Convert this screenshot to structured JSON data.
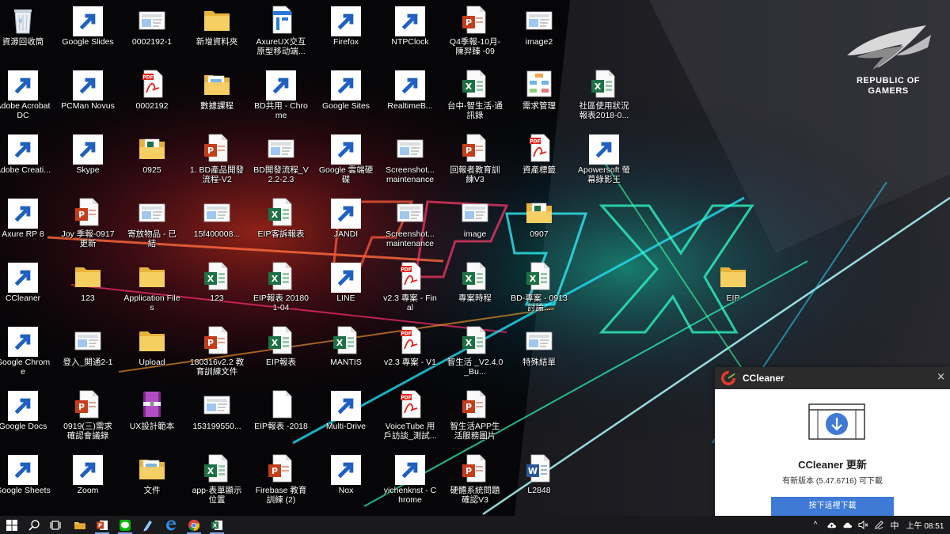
{
  "desktop": {
    "icons": [
      {
        "label": "資源回收筒",
        "icon": "recycle-bin-icon",
        "col": 0,
        "row": 0,
        "shortcut": false
      },
      {
        "label": "Google Slides",
        "icon": "google-slides-icon",
        "col": 1,
        "row": 0,
        "shortcut": true
      },
      {
        "label": "0002192-1",
        "icon": "image-file-icon",
        "col": 2,
        "row": 0,
        "shortcut": false
      },
      {
        "label": "新增資料夾",
        "icon": "folder-icon",
        "col": 3,
        "row": 0,
        "shortcut": false
      },
      {
        "label": "AxureUX交互原型移动端...",
        "icon": "axure-file-icon",
        "col": 4,
        "row": 0,
        "shortcut": false
      },
      {
        "label": "Firefox",
        "icon": "firefox-icon",
        "col": 5,
        "row": 0,
        "shortcut": true
      },
      {
        "label": "NTPClock",
        "icon": "ntpclock-icon",
        "col": 6,
        "row": 0,
        "shortcut": true
      },
      {
        "label": "Q4季報-10月-陳羿臻 -09",
        "icon": "powerpoint-file-icon",
        "col": 7,
        "row": 0,
        "shortcut": false
      },
      {
        "label": "image2",
        "icon": "image-file-icon",
        "col": 8,
        "row": 0,
        "shortcut": false
      },
      {
        "label": "Adobe Acrobat DC",
        "icon": "acrobat-icon",
        "col": 0,
        "row": 1,
        "shortcut": true
      },
      {
        "label": "PCMan Novus",
        "icon": "pcman-icon",
        "col": 1,
        "row": 1,
        "shortcut": true
      },
      {
        "label": "0002192",
        "icon": "pdf-file-icon",
        "col": 2,
        "row": 1,
        "shortcut": false
      },
      {
        "label": "數據課程",
        "icon": "folder-docs-icon",
        "col": 3,
        "row": 1,
        "shortcut": false
      },
      {
        "label": "BD共用 - Chrome",
        "icon": "chrome-profile-icon",
        "col": 4,
        "row": 1,
        "shortcut": true
      },
      {
        "label": "Google Sites",
        "icon": "chrome-icon",
        "col": 5,
        "row": 1,
        "shortcut": true
      },
      {
        "label": "RealtimeB...",
        "icon": "realtime-board-icon",
        "col": 6,
        "row": 1,
        "shortcut": true
      },
      {
        "label": "台中-智生活-通訊錄",
        "icon": "excel-file-icon",
        "col": 7,
        "row": 1,
        "shortcut": false
      },
      {
        "label": "需求管理",
        "icon": "diagram-file-icon",
        "col": 8,
        "row": 1,
        "shortcut": false
      },
      {
        "label": "社區使用狀況報表2018-0...",
        "icon": "excel-file-icon",
        "col": 9,
        "row": 1,
        "shortcut": false
      },
      {
        "label": "Adobe Creati...",
        "icon": "creative-cloud-icon",
        "col": 0,
        "row": 2,
        "shortcut": true
      },
      {
        "label": "Skype",
        "icon": "skype-icon",
        "col": 1,
        "row": 2,
        "shortcut": true
      },
      {
        "label": "0925",
        "icon": "folder-excel-icon",
        "col": 2,
        "row": 2,
        "shortcut": false
      },
      {
        "label": "1. BD產品開發流程-V2",
        "icon": "powerpoint-file-icon",
        "col": 3,
        "row": 2,
        "shortcut": false
      },
      {
        "label": "BD開發流程_V2.2-2.3",
        "icon": "image-file-icon",
        "col": 4,
        "row": 2,
        "shortcut": false
      },
      {
        "label": "Google 雲端硬碟",
        "icon": "google-drive-icon",
        "col": 5,
        "row": 2,
        "shortcut": true
      },
      {
        "label": "Screenshot... maintenance",
        "icon": "image-file-icon",
        "col": 6,
        "row": 2,
        "shortcut": false
      },
      {
        "label": "回報者教育訓練V3",
        "icon": "powerpoint-file-icon",
        "col": 7,
        "row": 2,
        "shortcut": false
      },
      {
        "label": "資產標籤",
        "icon": "pdf-file-icon",
        "col": 8,
        "row": 2,
        "shortcut": false
      },
      {
        "label": "Apowersoft 螢幕錄影王",
        "icon": "apowersoft-icon",
        "col": 9,
        "row": 2,
        "shortcut": true
      },
      {
        "label": "Axure RP 8",
        "icon": "axure-icon",
        "col": 0,
        "row": 3,
        "shortcut": true
      },
      {
        "label": "Joy 季報-0917更新",
        "icon": "powerpoint-file-icon",
        "col": 1,
        "row": 3,
        "shortcut": false
      },
      {
        "label": "寄放物品 - 已結",
        "icon": "image-file-icon",
        "col": 2,
        "row": 3,
        "shortcut": false
      },
      {
        "label": "15f400008...",
        "icon": "image-file-icon",
        "col": 3,
        "row": 3,
        "shortcut": false
      },
      {
        "label": "EIP客訴報表",
        "icon": "excel-file-icon",
        "col": 4,
        "row": 3,
        "shortcut": false
      },
      {
        "label": "JANDI",
        "icon": "jandi-icon",
        "col": 5,
        "row": 3,
        "shortcut": true
      },
      {
        "label": "Screenshot... maintenance",
        "icon": "image-file-icon",
        "col": 6,
        "row": 3,
        "shortcut": false
      },
      {
        "label": "image",
        "icon": "image-file-icon",
        "col": 7,
        "row": 3,
        "shortcut": false
      },
      {
        "label": "0907",
        "icon": "folder-excel-icon",
        "col": 8,
        "row": 3,
        "shortcut": false
      },
      {
        "label": "CCleaner",
        "icon": "ccleaner-icon",
        "col": 0,
        "row": 4,
        "shortcut": true
      },
      {
        "label": "123",
        "icon": "folder-icon",
        "col": 1,
        "row": 4,
        "shortcut": false
      },
      {
        "label": "Application Files",
        "icon": "folder-icon",
        "col": 2,
        "row": 4,
        "shortcut": false
      },
      {
        "label": "123",
        "icon": "excel-file-icon",
        "col": 3,
        "row": 4,
        "shortcut": false
      },
      {
        "label": "EIP報表 201801-04",
        "icon": "excel-file-icon",
        "col": 4,
        "row": 4,
        "shortcut": false
      },
      {
        "label": "LINE",
        "icon": "line-icon",
        "col": 5,
        "row": 4,
        "shortcut": true
      },
      {
        "label": "v2.3 專案 - Final",
        "icon": "pdf-file-icon",
        "col": 6,
        "row": 4,
        "shortcut": false
      },
      {
        "label": "專案時程",
        "icon": "excel-file-icon",
        "col": 7,
        "row": 4,
        "shortcut": false
      },
      {
        "label": "BD-專案 - 0913討論...",
        "icon": "excel-file-icon",
        "col": 8,
        "row": 4,
        "shortcut": false
      },
      {
        "label": "EIP",
        "icon": "folder-icon",
        "col": 11,
        "row": 4,
        "shortcut": false
      },
      {
        "label": "Google Chrome",
        "icon": "chrome-icon",
        "col": 0,
        "row": 5,
        "shortcut": true
      },
      {
        "label": "登入_開通2-1",
        "icon": "image-file-icon",
        "col": 1,
        "row": 5,
        "shortcut": false
      },
      {
        "label": "Upload",
        "icon": "folder-icon",
        "col": 2,
        "row": 5,
        "shortcut": false
      },
      {
        "label": "180316v2.2 教育訓練文件",
        "icon": "powerpoint-file-icon",
        "col": 3,
        "row": 5,
        "shortcut": false
      },
      {
        "label": "EIP報表",
        "icon": "excel-file-icon",
        "col": 4,
        "row": 5,
        "shortcut": false
      },
      {
        "label": "MANTIS",
        "icon": "excel-file-icon",
        "col": 5,
        "row": 5,
        "shortcut": false
      },
      {
        "label": "v2.3 專案 - V1",
        "icon": "pdf-file-icon",
        "col": 6,
        "row": 5,
        "shortcut": false
      },
      {
        "label": "智生活 _V2.4.0_Bu...",
        "icon": "excel-file-icon",
        "col": 7,
        "row": 5,
        "shortcut": false
      },
      {
        "label": "特殊結單",
        "icon": "image-file-icon",
        "col": 8,
        "row": 5,
        "shortcut": false
      },
      {
        "label": "Google Docs",
        "icon": "google-docs-icon",
        "col": 0,
        "row": 6,
        "shortcut": true
      },
      {
        "label": "0919(三)需求確認會議錄",
        "icon": "powerpoint-file-icon",
        "col": 1,
        "row": 6,
        "shortcut": false
      },
      {
        "label": "UX設計範本",
        "icon": "winrar-icon",
        "col": 2,
        "row": 6,
        "shortcut": false
      },
      {
        "label": "153199550...",
        "icon": "image-file-icon",
        "col": 3,
        "row": 6,
        "shortcut": false
      },
      {
        "label": "EIP報表 -2018",
        "icon": "blank-file-icon",
        "col": 4,
        "row": 6,
        "shortcut": false
      },
      {
        "label": "Multi-Drive",
        "icon": "nox-icon",
        "col": 5,
        "row": 6,
        "shortcut": true
      },
      {
        "label": "VoiceTube 用戶訪談_測試...",
        "icon": "pdf-file-icon",
        "col": 6,
        "row": 6,
        "shortcut": false
      },
      {
        "label": "智生活APP生活服務圖片",
        "icon": "powerpoint-file-icon",
        "col": 7,
        "row": 6,
        "shortcut": false
      },
      {
        "label": "Google Sheets",
        "icon": "google-sheets-icon",
        "col": 0,
        "row": 7,
        "shortcut": true
      },
      {
        "label": "Zoom",
        "icon": "zoom-icon",
        "col": 1,
        "row": 7,
        "shortcut": true
      },
      {
        "label": "文件",
        "icon": "folder-docs-icon",
        "col": 2,
        "row": 7,
        "shortcut": false
      },
      {
        "label": "app-表單顯示位置",
        "icon": "excel-file-icon",
        "col": 3,
        "row": 7,
        "shortcut": false
      },
      {
        "label": "Firebase 教育訓練 (2)",
        "icon": "powerpoint-file-icon",
        "col": 4,
        "row": 7,
        "shortcut": false
      },
      {
        "label": "Nox",
        "icon": "nox-icon",
        "col": 5,
        "row": 7,
        "shortcut": true
      },
      {
        "label": "yichenknst - Chrome",
        "icon": "chrome-profile-icon",
        "col": 6,
        "row": 7,
        "shortcut": true
      },
      {
        "label": "硬體系統問題確認V3",
        "icon": "powerpoint-file-icon",
        "col": 7,
        "row": 7,
        "shortcut": false
      },
      {
        "label": "L2848",
        "icon": "word-file-icon",
        "col": 8,
        "row": 7,
        "shortcut": false
      }
    ]
  },
  "wallpaper": {
    "brand_line1": "REPUBLIC OF",
    "brand_line2": "GAMERS",
    "logo_icon": "rog-eye-icon"
  },
  "notification": {
    "app_name": "CCleaner",
    "close_glyph": "×",
    "heading": "CCleaner 更新",
    "message": "有新版本 (5.47.6716) 可下載",
    "button_label": "按下這裡下載",
    "icon": "ccleaner-icon",
    "hero_icon": "download-window-icon"
  },
  "taskbar": {
    "items": [
      {
        "name": "start-button",
        "icon": "windows-icon"
      },
      {
        "name": "search-button",
        "icon": "search-icon"
      },
      {
        "name": "task-view-button",
        "icon": "task-view-icon"
      },
      {
        "name": "taskbar-file-explorer",
        "icon": "folder-icon"
      },
      {
        "name": "taskbar-powerpoint",
        "icon": "powerpoint-icon",
        "active": true
      },
      {
        "name": "taskbar-line",
        "icon": "line-icon",
        "active": true
      },
      {
        "name": "taskbar-notes",
        "icon": "notepad-icon"
      },
      {
        "name": "taskbar-edge",
        "icon": "edge-icon"
      },
      {
        "name": "taskbar-chrome",
        "icon": "chrome-icon",
        "active": true
      },
      {
        "name": "taskbar-excel",
        "icon": "excel-icon",
        "active": true
      }
    ],
    "tray": {
      "chevron": "^",
      "input_method": "中",
      "clock": "上午 08:51"
    }
  },
  "colors": {
    "excel": "#1e7145",
    "powerpoint": "#c43e1c",
    "pdf": "#e2231a",
    "folder": "#f2c14e",
    "accent_blue": "#3e7ad6"
  }
}
